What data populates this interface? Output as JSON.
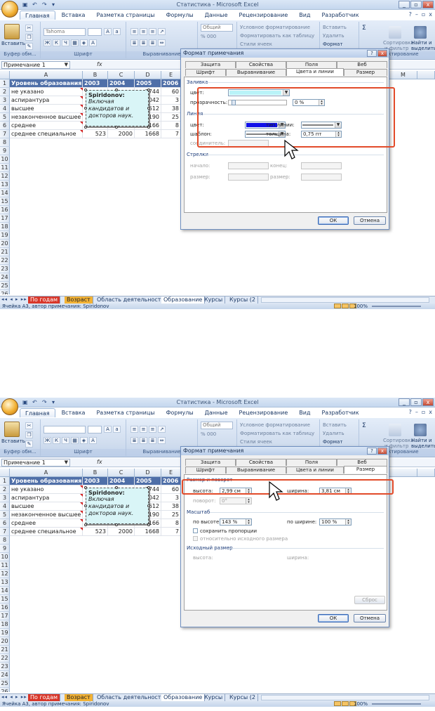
{
  "window": {
    "title": "Статистика - Microsoft Excel",
    "tabs": [
      "Главная",
      "Вставка",
      "Разметка страницы",
      "Формулы",
      "Данные",
      "Рецензирование",
      "Вид",
      "Разработчик"
    ],
    "active_tab": "Главная"
  },
  "ribbon": {
    "groups": {
      "clipboard": "Буфер обм...",
      "font": "Шрифт",
      "align": "Выравнивание",
      "styles": "Стили",
      "edit": "Редактирование"
    },
    "paste_label": "Вставить",
    "font_name": "Tahoma",
    "number_format": "Общий",
    "cond_format": "Условное форматирование",
    "format_table": "Форматировать как таблицу",
    "cell_styles": "Стили ячеек",
    "insert": "Вставить",
    "delete": "Удалить",
    "format": "Формат",
    "sort": "Сортировка и фильтр",
    "find": "Найти и выделить",
    "sigma": "Σ",
    "sort_short": "Сортировка",
    "find_short": "Найти и",
    "filter_short": "и фильтр",
    "select_short": "выделить",
    "percent_btn": "% 000",
    "format_table_short": "Форматировать как таблицу"
  },
  "formula_bar": {
    "name_box": "Примечание 1",
    "fx": "fx"
  },
  "sheet": {
    "columns": [
      "A",
      "B",
      "C",
      "D",
      "E",
      "M"
    ],
    "header_row": [
      "Уровень образования",
      "2003",
      "2004",
      "2005",
      "2006"
    ],
    "rows": [
      [
        "не указано",
        "",
        "",
        "3744",
        "60"
      ],
      [
        "аспирантура",
        "",
        "",
        "1042",
        "3"
      ],
      [
        "высшее",
        "",
        "",
        "0612",
        "38"
      ],
      [
        "незаконченное высшее",
        "",
        "",
        "6190",
        "25"
      ],
      [
        "среднее",
        "",
        "",
        "3166",
        "8"
      ],
      [
        "среднее специальное",
        "523",
        "2000",
        "1668",
        "7"
      ]
    ],
    "row_numbers": [
      "1",
      "2",
      "3",
      "4",
      "5",
      "6",
      "7",
      "8",
      "9",
      "10",
      "11",
      "12",
      "13",
      "14",
      "15",
      "16",
      "17",
      "18",
      "19",
      "20",
      "21",
      "22",
      "23",
      "24",
      "25",
      "26"
    ]
  },
  "comment": {
    "author": "Spiridonov:",
    "text": "Включая кандидатов и докторов наук."
  },
  "sheet_tabs": [
    "По годам",
    "Возраст",
    "Область деятельности",
    "Образование",
    "Курсы",
    "Курсы (2"
  ],
  "active_sheet": "Образование",
  "status": {
    "text": "Ячейка A3, автор примечания: Spiridonov",
    "zoom": "100%"
  },
  "dialog": {
    "title": "Формат примечания",
    "tabs_row1": [
      "Защита",
      "Свойства",
      "Поля",
      "Веб"
    ],
    "tabs_row2": [
      "Шрифт",
      "Выравнивание",
      "Цвета и линии",
      "Размер"
    ],
    "ok": "ОК",
    "cancel": "Отмена",
    "colors": {
      "active_tab": "Цвета и линии",
      "fill_title": "Заливка",
      "color_label": "цвет:",
      "fill_color": "#b9f3f8",
      "transparency_label": "прозрачность:",
      "transparency_value": "0 %",
      "line_title": "Линия",
      "line_color_label": "цвет:",
      "line_color": "#1010e8",
      "line_type_label": "тип линии:",
      "pattern_label": "шаблон:",
      "thickness_label": "толщина:",
      "thickness_value": "0,75 пт",
      "connector_label": "соединитель:",
      "arrows_title": "Стрелки",
      "begin_label": "начало:",
      "end_label": "конец:",
      "size_label": "размер:",
      "size2_label": "размер:"
    },
    "size": {
      "active_tab": "Размер",
      "size_rot_title": "Размер и поворот",
      "height_label": "высота:",
      "height_value": "2,99 см",
      "width_label": "ширина:",
      "width_value": "3,81 см",
      "rotation_label": "поворот:",
      "rotation_value": "0°",
      "scale_title": "Масштаб",
      "scale_h_label": "по высоте:",
      "scale_h_value": "143 %",
      "scale_w_label": "по ширине:",
      "scale_w_value": "100 %",
      "keep_ratio": "сохранить пропорции",
      "relative": "относительно исходного размера",
      "orig_title": "Исходный размер",
      "orig_h": "высота:",
      "orig_w": "ширина:",
      "reset": "Сброс"
    }
  }
}
